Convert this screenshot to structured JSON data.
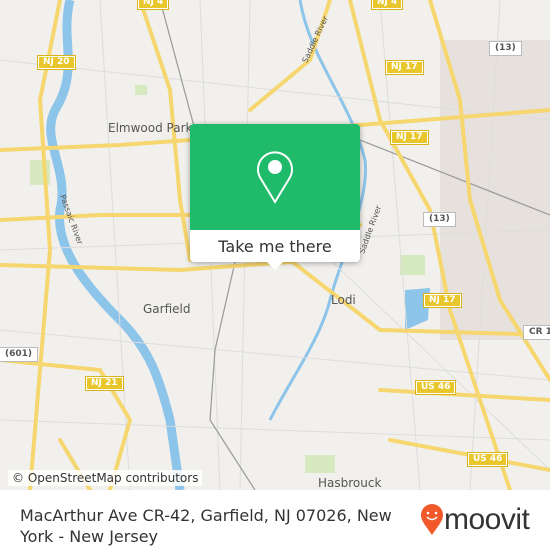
{
  "map": {
    "places": [
      "Elmwood Park",
      "Garfield",
      "Lodi",
      "Hasbrouck"
    ],
    "park_label": "Park",
    "shields": [
      "NJ 20",
      "NJ 4",
      "NJ 4",
      "(13)",
      "NJ 17",
      "NJ 17",
      "(13)",
      "NJ 17",
      "CR 1",
      "(601)",
      "NJ 21",
      "US 46",
      "US 46"
    ],
    "waterways": [
      "Saddle River",
      "Passaic River",
      "Saddle River"
    ],
    "attribution": "© OpenStreetMap contributors",
    "colors": {
      "land": "#f2f0ec",
      "road": "#f6d66e",
      "water": "#8cc4ea",
      "park": "#cfe8b4",
      "accent": "#1fbb6b"
    }
  },
  "popup": {
    "button_label": "Take me there",
    "icon": "map-pin-icon"
  },
  "footer": {
    "address": "MacArthur Ave CR-42, Garfield, NJ 07026, New York - New Jersey",
    "brand": "moovit",
    "brand_color": "#f1592a"
  }
}
